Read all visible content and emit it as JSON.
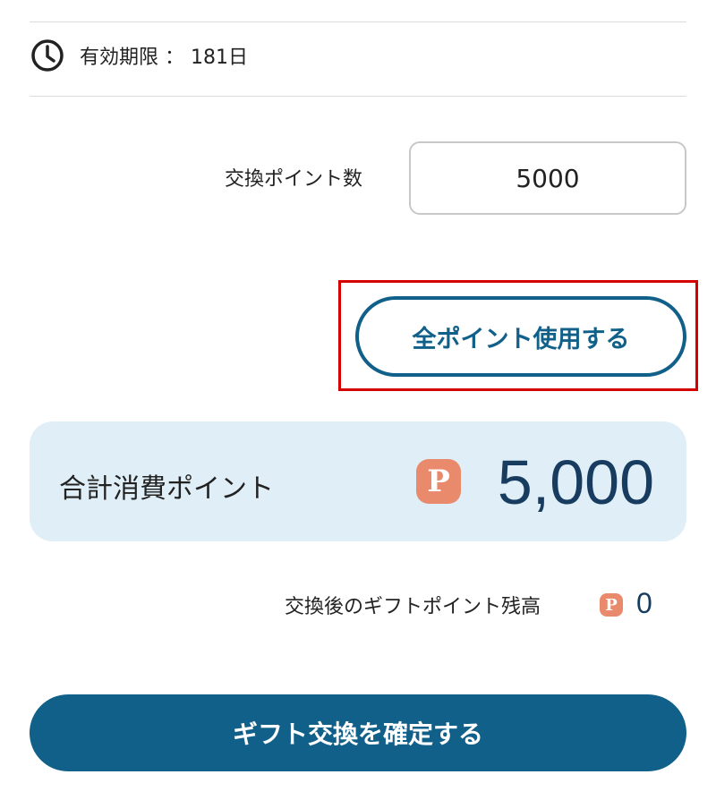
{
  "expiry": {
    "icon": "clock-icon",
    "text": "有効期限 ： 181日"
  },
  "exchange": {
    "label": "交換ポイント数",
    "input_value": "5000"
  },
  "use_all_button": {
    "label": "全ポイント使用する",
    "highlight_color": "#d40000"
  },
  "total": {
    "label": "合計消費ポイント",
    "badge": "P",
    "value": "5,000"
  },
  "balance": {
    "label": "交換後のギフトポイント残高",
    "badge": "P",
    "value": "0"
  },
  "confirm_button": {
    "label": "ギフト交換を確定する"
  },
  "colors": {
    "primary": "#11608a",
    "panel_background": "#dfeef7",
    "point_badge": "#e98a6c",
    "value_text": "#173c5f"
  }
}
